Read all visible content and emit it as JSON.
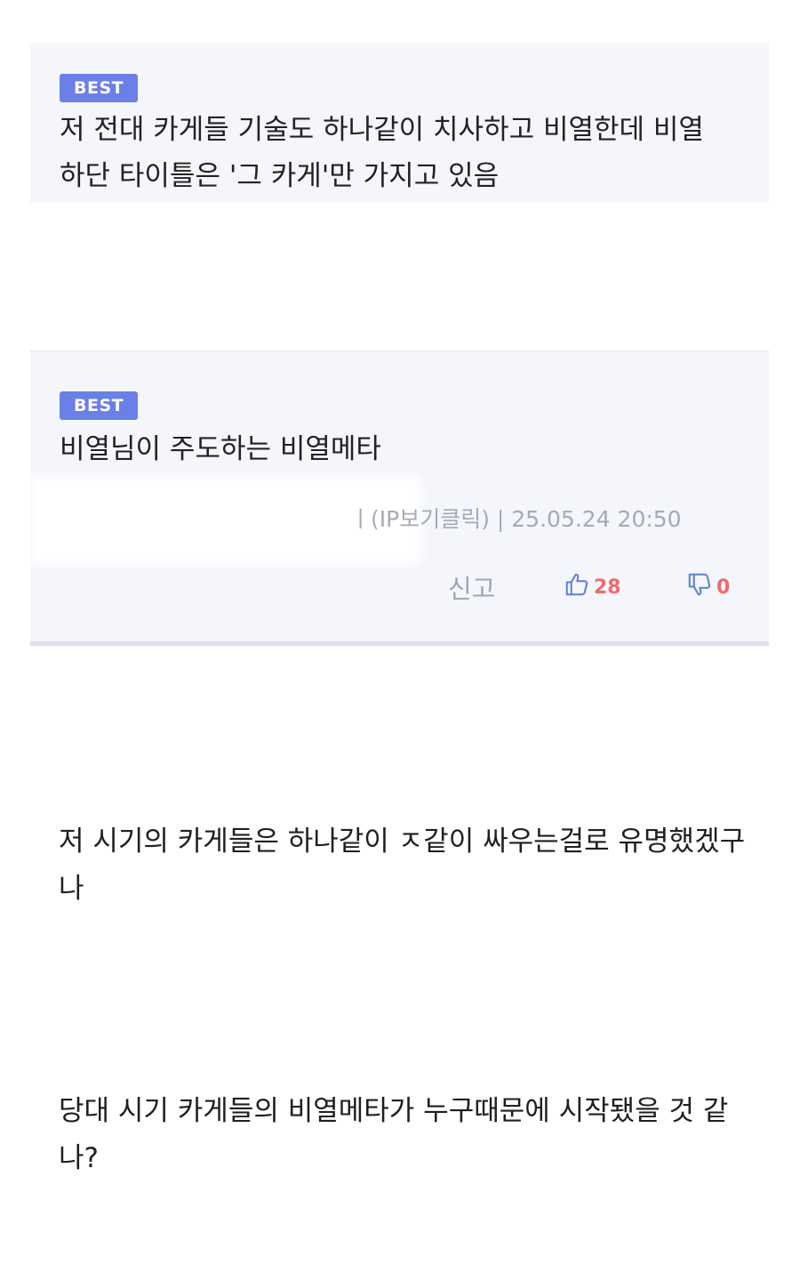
{
  "comments": [
    {
      "badge": "BEST",
      "text": "저 전대 카게들 기술도 하나같이 치사하고 비열한데 비열하단 타이틀은 '그 카게'만 가지고 있음"
    },
    {
      "badge": "BEST",
      "text": "비열님이 주도하는 비열메타",
      "meta": "ㅣ(IP보기클릭) | 25.05.24 20:50",
      "report_label": "신고",
      "likes": "28",
      "dislikes": "0"
    }
  ],
  "posts": [
    {
      "text": "저 시기의 카게들은 하나같이 ㅈ같이 싸우는걸로 유명했겠구나"
    },
    {
      "text": "당대 시기 카게들의 비열메타가 누구때문에 시작됐을 것 같나?"
    }
  ],
  "colors": {
    "badge": "#6a80e6",
    "card_bg": "#f4f6fb",
    "vote": "#ef6b6b",
    "vote_icon": "#5b7fd8"
  }
}
